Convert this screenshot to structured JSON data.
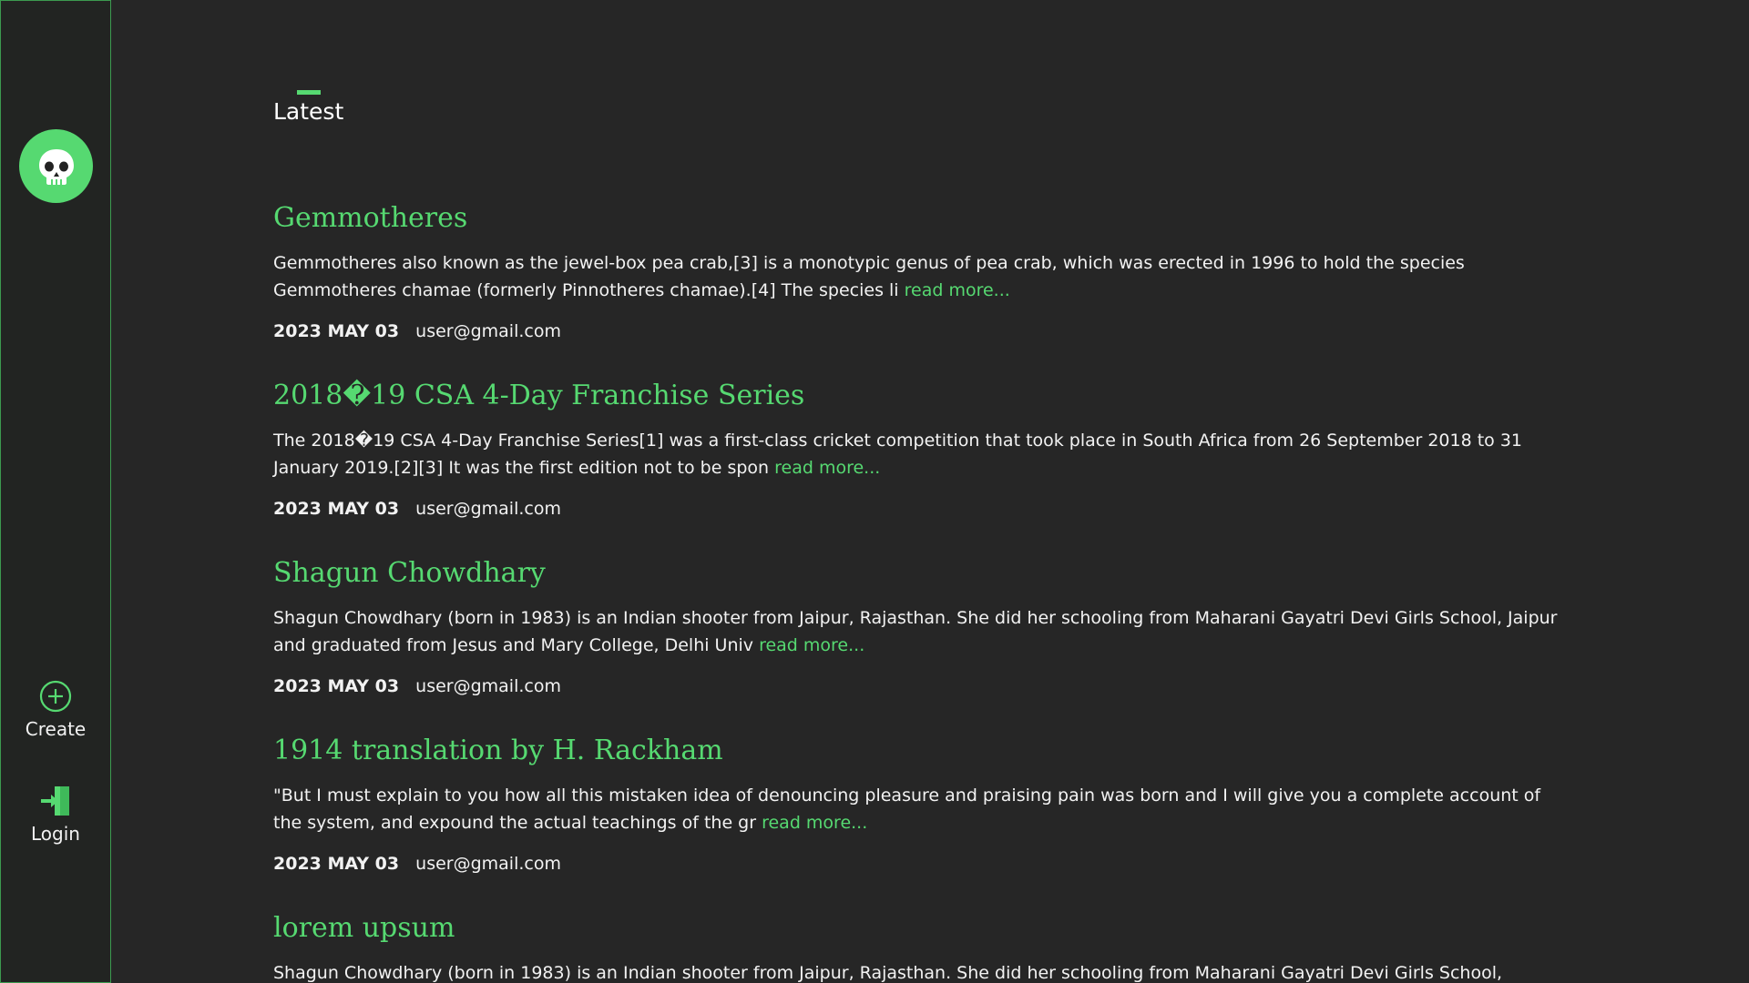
{
  "sidebar": {
    "logo_icon": "skull-icon",
    "create_label": "Create",
    "create_icon": "plus-circle-icon",
    "login_label": "Login",
    "login_icon": "login-door-icon"
  },
  "colors": {
    "accent": "#56d971",
    "background": "#262626",
    "sidebar_border": "#3c9a4f"
  },
  "main": {
    "heading": "Latest",
    "posts": [
      {
        "title": "Gemmotheres",
        "excerpt": "Gemmotheres also known as the jewel-box pea crab,[3] is a monotypic genus of pea crab, which was erected in 1996 to hold the species Gemmotheres chamae (formerly Pinnotheres chamae).[4] The species li",
        "read_more": "read more...",
        "date": "2023 MAY 03",
        "author": "user@gmail.com"
      },
      {
        "title": "2018�19 CSA 4-Day Franchise Series",
        "excerpt": "The 2018�19 CSA 4-Day Franchise Series[1] was a first-class cricket competition that took place in South Africa from 26 September 2018 to 31 January 2019.[2][3] It was the first edition not to be spon",
        "read_more": "read more...",
        "date": "2023 MAY 03",
        "author": "user@gmail.com"
      },
      {
        "title": "Shagun Chowdhary",
        "excerpt": "Shagun Chowdhary (born in 1983) is an Indian shooter from Jaipur, Rajasthan. She did her schooling from Maharani Gayatri Devi Girls School, Jaipur and graduated from Jesus and Mary College, Delhi Univ",
        "read_more": "read more...",
        "date": "2023 MAY 03",
        "author": "user@gmail.com"
      },
      {
        "title": "1914 translation by H. Rackham",
        "excerpt": "\"But I must explain to you how all this mistaken idea of denouncing pleasure and praising pain was born and I will give you a complete account of the system, and expound the actual teachings of the gr",
        "read_more": "read more...",
        "date": "2023 MAY 03",
        "author": "user@gmail.com"
      },
      {
        "title": "lorem upsum",
        "excerpt": "Shagun Chowdhary (born in 1983) is an Indian shooter from Jaipur, Rajasthan. She did her schooling from Maharani Gayatri Devi Girls School,"
      }
    ]
  }
}
